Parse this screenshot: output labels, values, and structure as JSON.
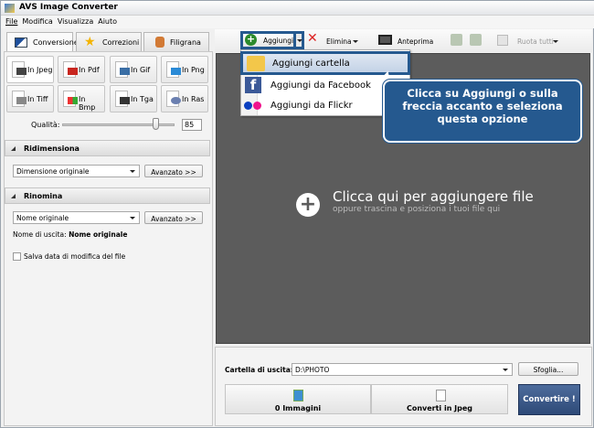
{
  "window": {
    "title": "AVS Image Converter"
  },
  "menu": [
    "File",
    "Modifica",
    "Visualizza",
    "Aiuto"
  ],
  "tabs": [
    "Conversione",
    "Correzioni",
    "Filigrana"
  ],
  "formats": [
    "In Jpeg",
    "In Pdf",
    "In Gif",
    "In Png",
    "In Tiff",
    "In Bmp",
    "In Tga",
    "In Ras"
  ],
  "quality": {
    "label": "Qualità:",
    "value": "85",
    "slider_percent": 85
  },
  "resize": {
    "title": "Ridimensiona",
    "selected": "Dimensione originale",
    "advanced": "Avanzato >>"
  },
  "rename": {
    "title": "Rinomina",
    "selected": "Nome originale",
    "advanced": "Avanzato >>",
    "output_label": "Nome di uscita:",
    "output_value": "Nome originale"
  },
  "save_date": {
    "label": "Salva data di modifica del file",
    "checked": false
  },
  "toolbar": {
    "add": "Aggiungi",
    "delete": "Elimina",
    "preview": "Anteprima",
    "rotate_all": "Ruota tutti"
  },
  "add_menu": [
    "Aggiungi cartella",
    "Aggiungi da Facebook",
    "Aggiungi da Flickr"
  ],
  "callout": "Clicca su Aggiungi o sulla freccia accanto e seleziona questa opzione",
  "dropzone": {
    "title": "Clicca qui per aggiungere file",
    "subtitle": "oppure trascina e posiziona i tuoi file qui"
  },
  "output": {
    "label": "Cartella di uscita:",
    "value": "D:\\PHOTO",
    "browse": "Sfoglia..."
  },
  "steps": [
    "0 Immagini",
    "Converti in Jpeg"
  ],
  "convert": "Convertire !",
  "colors": {
    "accent": "#25598f",
    "dropzone": "#5c5c5c"
  }
}
